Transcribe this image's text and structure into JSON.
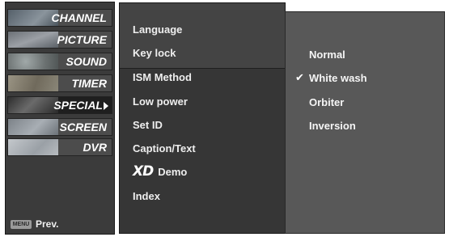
{
  "main_menu": {
    "items": [
      {
        "label": "CHANNEL",
        "selected": false,
        "thumb_color": "#6f7a84"
      },
      {
        "label": "PICTURE",
        "selected": false,
        "thumb_color": "#7c828a"
      },
      {
        "label": "SOUND",
        "selected": false,
        "thumb_color": "#808888"
      },
      {
        "label": "TIMER",
        "selected": false,
        "thumb_color": "#8a8576"
      },
      {
        "label": "SPECIAL",
        "selected": true,
        "thumb_color": "#5e5e5e"
      },
      {
        "label": "SCREEN",
        "selected": false,
        "thumb_color": "#8c9196"
      },
      {
        "label": "DVR",
        "selected": false,
        "thumb_color": "#b0b4b8"
      }
    ]
  },
  "footer": {
    "menu_key": "MENU",
    "prev_label": "Prev."
  },
  "special_menu": {
    "items": [
      {
        "label": "Language"
      },
      {
        "label": "Key lock"
      },
      {
        "label": "ISM Method"
      },
      {
        "label": "Low power"
      },
      {
        "label": "Set ID"
      },
      {
        "label": "Caption/Text"
      },
      {
        "label": "Demo",
        "badge": "XD"
      },
      {
        "label": "Index"
      }
    ]
  },
  "ism_options": {
    "selected": "White wash",
    "items": [
      {
        "label": "Normal"
      },
      {
        "label": "White wash",
        "checked": true
      },
      {
        "label": "Orbiter"
      },
      {
        "label": "Inversion"
      }
    ]
  }
}
